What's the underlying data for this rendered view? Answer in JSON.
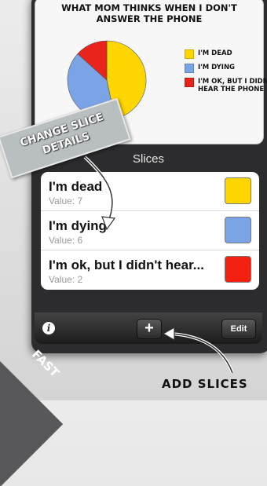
{
  "chart_card": {
    "title": "WHAT MOM THINKS WHEN I DON'T\nANSWER THE PHONE"
  },
  "chart_data": {
    "type": "pie",
    "slices": [
      {
        "label": "I'M DEAD",
        "value": 7,
        "color": "#ffd600"
      },
      {
        "label": "I'M DYING",
        "value": 6,
        "color": "#7aa4e6"
      },
      {
        "label": "I'M OK, BUT I DIDN'T HEAR THE PHONE",
        "value": 2,
        "color": "#e8241c"
      }
    ]
  },
  "slices_header": "Slices",
  "slices": [
    {
      "name": "I'm dead",
      "value": "Value: 7",
      "color": "#ffd600"
    },
    {
      "name": "I'm dying",
      "value": "Value: 6",
      "color": "#7aa4e6"
    },
    {
      "name": "I'm ok, but I didn't hear...",
      "value": "Value: 2",
      "color": "#f22010"
    }
  ],
  "toolbar": {
    "info_label": "i",
    "add_label": "+",
    "edit_label": "Edit"
  },
  "callout_text": "CHANGE SLICE\nDETAILS",
  "add_slices_label": "ADD SLICES",
  "fast_label": "FAST",
  "icons": [
    "info-icon",
    "plus-icon"
  ]
}
